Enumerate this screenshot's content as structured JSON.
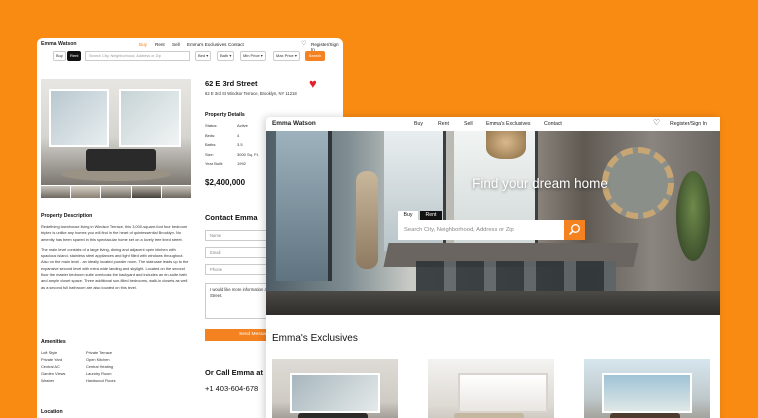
{
  "back": {
    "brand": "Emma Watson",
    "nav": [
      "Buy",
      "Rent",
      "Sell",
      "Emma's Exclusives",
      "Contact"
    ],
    "register": "Register/Sign In",
    "search": {
      "buy": "Buy",
      "rent": "Rent",
      "placeholder": "Search City, Neighborhood, Address or Zip",
      "bed": "Bed",
      "bath": "Bath",
      "min_price": "Min Price",
      "max_price": "Max Price",
      "button": "Search"
    },
    "listing": {
      "street": "62 E 3rd Street",
      "address": "62 E 3rd St Windsor Terrace, Brooklyn, NY 11218",
      "details_title": "Property Details",
      "details": [
        {
          "k": "Status:",
          "v": "Active"
        },
        {
          "k": "Beds:",
          "v": "4"
        },
        {
          "k": "Baths:",
          "v": "3.5"
        },
        {
          "k": "Size:",
          "v": "3000 Sq. Ft."
        },
        {
          "k": "Year Built:",
          "v": "1992"
        }
      ],
      "price": "$2,400,000"
    },
    "description": {
      "title": "Property Description",
      "p1": "Redefining townhouse living in Windsor Terrace, this 3,000-square-foot four bedroom triplex is unlike any homes you will find in the heart of quintessential Brooklyn. No amenity has been spared in this spectacular home set on a lovely tree lined street.",
      "p2": "The main level consists of a large living, dining and adjacent open kitchen with spacious island, stainless steel appliances and light filled with windows throughout. Also on the main level - an ideally located powder room. The staircase leads up to the expansive second level with extra wide landing and skylight. Located on the second floor the master bedroom suite overlooks the backyard and includes an en-suite bath and ample closet space. Three additional sun-filled bedrooms, walk-in closets as well as a second full bathroom are also located on this level."
    },
    "amenities": {
      "title": "Amenities",
      "items": [
        "Loft Style",
        "Private Terrace",
        "Private Yard",
        "Open Kitchen",
        "Central AC",
        "Central Heating",
        "Garden Views",
        "Laundry Room",
        "Washer",
        "Hardwood Floors"
      ]
    },
    "location_title": "Location",
    "contact": {
      "title": "Contact Emma",
      "name": "Name",
      "email": "Email",
      "phone": "Phone",
      "message": "I would like more information about 315 22nd Street.",
      "send": "Send Message",
      "call": "Or Call Emma at",
      "phone_number": "+1 403-604-678"
    }
  },
  "front": {
    "brand": "Emma Watson",
    "nav": [
      "Buy",
      "Rent",
      "Sell",
      "Emma's Exclusives",
      "Contact"
    ],
    "register": "Register/Sign In",
    "hero": {
      "title": "Find your dream home",
      "tab_buy": "Buy",
      "tab_rent": "Rent",
      "placeholder": "Search City, Neighborhood, Address or Zip"
    },
    "exclusives_title": "Emma's Exclusives"
  },
  "colors": {
    "background": "#F98B12",
    "accent": "#F58220",
    "heart": "#E1202A"
  }
}
